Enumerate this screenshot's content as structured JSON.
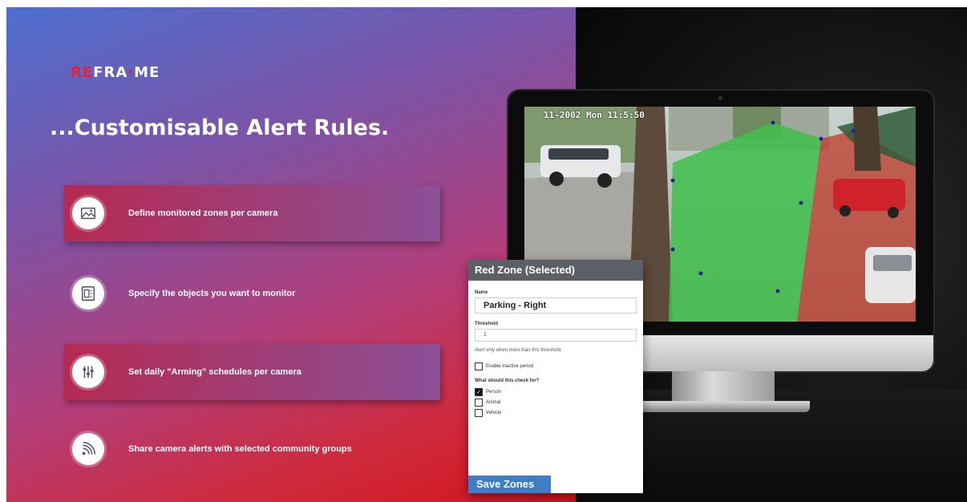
{
  "brand": {
    "logo_re": "RE",
    "logo_fr": "FRA",
    "logo_dot": "·",
    "logo_me": "ME"
  },
  "headline": "...Customisable Alert Rules.",
  "features": [
    {
      "label": "Define monitored zones per camera",
      "icon": "map-image-icon",
      "boxed": true
    },
    {
      "label": "Specify the objects you want to monitor",
      "icon": "object-frame-icon",
      "boxed": false
    },
    {
      "label": "Set daily \"Arming\" schedules per camera",
      "icon": "sliders-icon",
      "boxed": true
    },
    {
      "label": "Share camera alerts with selected community groups",
      "icon": "broadcast-icon",
      "boxed": false
    }
  ],
  "camera": {
    "timestamp": "11-2002 Mon 11:5:50"
  },
  "zone_dialog": {
    "title": "Red Zone (Selected)",
    "name_label": "Name",
    "name_value": "Parking - Right",
    "threshold_label": "Threshold",
    "threshold_value": "1",
    "threshold_help": "Alert only when more than this threshold.",
    "inactive_label": "Enable inactive period",
    "check_for_label": "What should this check for?",
    "options": [
      {
        "label": "Person",
        "checked": true
      },
      {
        "label": "Animal",
        "checked": false
      },
      {
        "label": "Vehicle",
        "checked": false
      }
    ],
    "save_label": "Save Zones"
  },
  "colors": {
    "accent_red": "#e0233a",
    "save_blue": "#3d7fc7",
    "green_zone": "#3fbf4a",
    "red_zone": "#c0392b"
  }
}
